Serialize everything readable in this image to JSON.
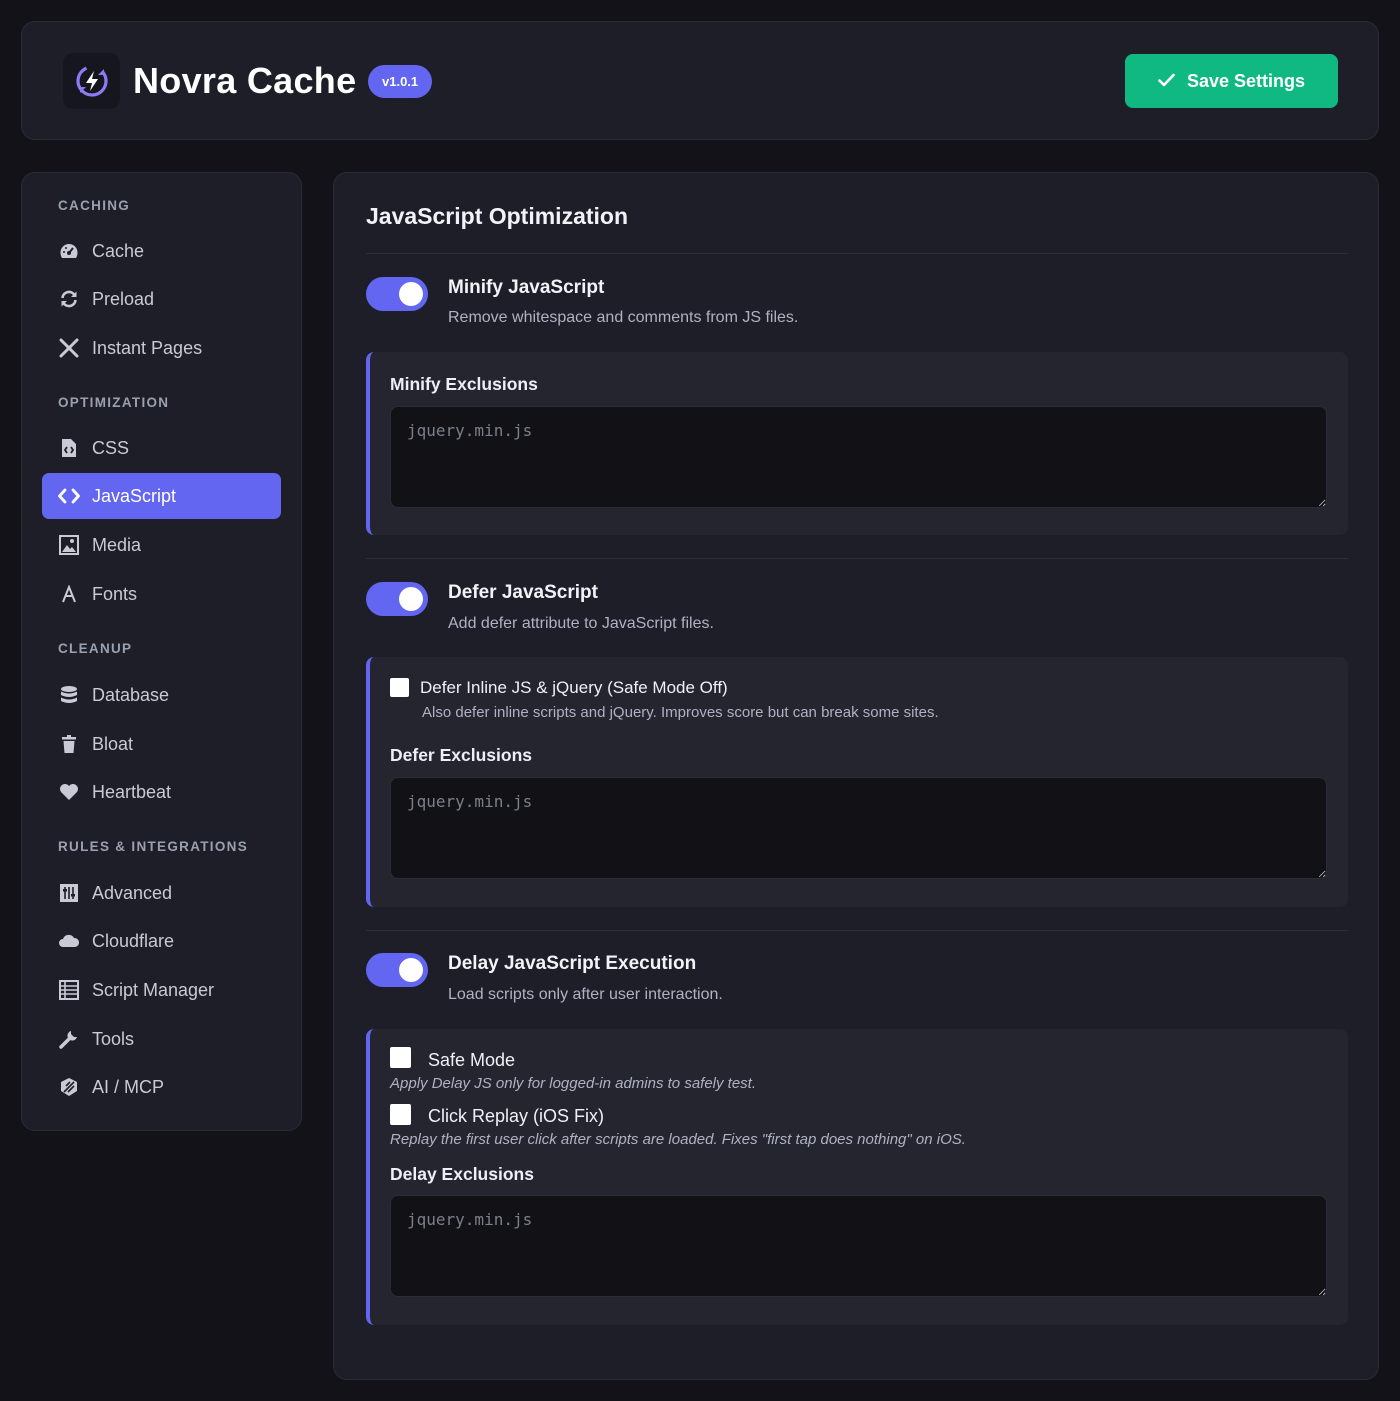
{
  "header": {
    "app_name": "Novra Cache",
    "version": "v1.0.1",
    "logo_icon": "bolt-refresh-icon",
    "save_label": "Save Settings",
    "save_icon": "check-icon"
  },
  "sidebar": {
    "sections": [
      {
        "label": "CACHING",
        "items": [
          {
            "label": "Cache",
            "icon": "gauge-icon"
          },
          {
            "label": "Preload",
            "icon": "refresh-icon"
          },
          {
            "label": "Instant Pages",
            "icon": "plane-icon"
          }
        ]
      },
      {
        "label": "OPTIMIZATION",
        "items": [
          {
            "label": "CSS",
            "icon": "file-code-icon"
          },
          {
            "label": "JavaScript",
            "icon": "code-icon",
            "active": true
          },
          {
            "label": "Media",
            "icon": "image-icon"
          },
          {
            "label": "Fonts",
            "icon": "font-icon"
          }
        ]
      },
      {
        "label": "CLEANUP",
        "items": [
          {
            "label": "Database",
            "icon": "database-icon"
          },
          {
            "label": "Bloat",
            "icon": "trash-icon"
          },
          {
            "label": "Heartbeat",
            "icon": "heart-icon"
          }
        ]
      },
      {
        "label": "RULES & INTEGRATIONS",
        "items": [
          {
            "label": "Advanced",
            "icon": "sliders-icon"
          },
          {
            "label": "Cloudflare",
            "icon": "cloud-icon"
          },
          {
            "label": "Script Manager",
            "icon": "list-icon"
          },
          {
            "label": "Tools",
            "icon": "wrench-icon"
          },
          {
            "label": "AI / MCP",
            "icon": "ai-icon"
          }
        ]
      }
    ]
  },
  "main": {
    "title": "JavaScript Optimization",
    "minify": {
      "title": "Minify JavaScript",
      "desc": "Remove whitespace and comments from JS files.",
      "enabled": true,
      "exclusions_label": "Minify Exclusions",
      "exclusions_placeholder": "jquery.min.js",
      "exclusions_value": ""
    },
    "defer": {
      "title": "Defer JavaScript",
      "desc": "Add defer attribute to JavaScript files.",
      "enabled": true,
      "inline_label": "Defer Inline JS & jQuery (Safe Mode Off)",
      "inline_help": "Also defer inline scripts and jQuery. Improves score but can break some sites.",
      "inline_checked": false,
      "exclusions_label": "Defer Exclusions",
      "exclusions_placeholder": "jquery.min.js",
      "exclusions_value": ""
    },
    "delay": {
      "title": "Delay JavaScript Execution",
      "desc": "Load scripts only after user interaction.",
      "enabled": true,
      "safe_mode_label": "Safe Mode",
      "safe_mode_help": "Apply Delay JS only for logged-in admins to safely test.",
      "safe_mode_checked": false,
      "click_replay_label": "Click Replay (iOS Fix)",
      "click_replay_help": "Replay the first user click after scripts are loaded. Fixes \"first tap does nothing\" on iOS.",
      "click_replay_checked": false,
      "exclusions_label": "Delay Exclusions",
      "exclusions_placeholder": "jquery.min.js",
      "exclusions_value": ""
    }
  },
  "colors": {
    "accent": "#6366f1",
    "save": "#10b981",
    "background": "#121218",
    "panel": "#1e1e28"
  }
}
